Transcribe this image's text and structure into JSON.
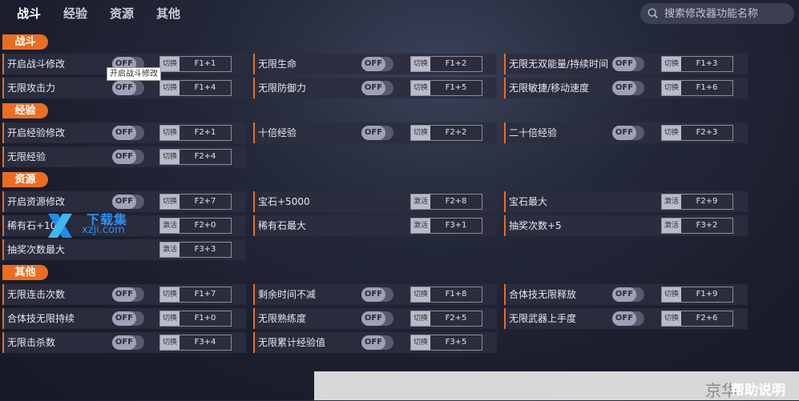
{
  "tabs": [
    {
      "label": "战斗",
      "active": true
    },
    {
      "label": "经验",
      "active": false
    },
    {
      "label": "资源",
      "active": false
    },
    {
      "label": "其他",
      "active": false
    }
  ],
  "search": {
    "placeholder": "搜索修改器功能名称"
  },
  "sections": [
    {
      "title": "战斗"
    },
    {
      "title": "经验"
    },
    {
      "title": "资源"
    },
    {
      "title": "其他"
    }
  ],
  "rows": [
    {
      "label": "开启战斗修改",
      "toggle": "OFF",
      "mode": "切换",
      "key": "F1+1"
    },
    {
      "label": "无限生命",
      "toggle": "OFF",
      "mode": "切换",
      "key": "F1+2"
    },
    {
      "label": "无限无双能量/持续时间",
      "toggle": "OFF",
      "mode": "切换",
      "key": "F1+3"
    },
    {
      "label": "无限攻击力",
      "toggle": "OFF",
      "mode": "切换",
      "key": "F1+4"
    },
    {
      "label": "无限防御力",
      "toggle": "OFF",
      "mode": "切换",
      "key": "F1+5"
    },
    {
      "label": "无限敏捷/移动速度",
      "toggle": "OFF",
      "mode": "切换",
      "key": "F1+6"
    },
    {
      "label": "开启经验修改",
      "toggle": "OFF",
      "mode": "切换",
      "key": "F2+1"
    },
    {
      "label": "十倍经验",
      "toggle": "OFF",
      "mode": "切换",
      "key": "F2+2"
    },
    {
      "label": "二十倍经验",
      "toggle": "OFF",
      "mode": "切换",
      "key": "F2+3"
    },
    {
      "label": "无限经验",
      "toggle": "OFF",
      "mode": "切换",
      "key": "F2+4"
    },
    {
      "label": "开启资源修改",
      "toggle": "OFF",
      "mode": "切换",
      "key": "F2+7"
    },
    {
      "label": "宝石+5000",
      "toggle": null,
      "mode": "激活",
      "key": "F2+8"
    },
    {
      "label": "宝石最大",
      "toggle": null,
      "mode": "激活",
      "key": "F2+9"
    },
    {
      "label": "稀有石+10",
      "toggle": null,
      "mode": "激活",
      "key": "F2+0"
    },
    {
      "label": "稀有石最大",
      "toggle": null,
      "mode": "激活",
      "key": "F3+1"
    },
    {
      "label": "抽奖次数+5",
      "toggle": null,
      "mode": "激活",
      "key": "F3+2"
    },
    {
      "label": "抽奖次数最大",
      "toggle": null,
      "mode": "激活",
      "key": "F3+3"
    },
    {
      "label": "无限连击次数",
      "toggle": "OFF",
      "mode": "切换",
      "key": "F1+7"
    },
    {
      "label": "剩余时间不减",
      "toggle": "OFF",
      "mode": "切换",
      "key": "F1+8"
    },
    {
      "label": "合体技无限释放",
      "toggle": "OFF",
      "mode": "切换",
      "key": "F1+9"
    },
    {
      "label": "合体技无限持续",
      "toggle": "OFF",
      "mode": "切换",
      "key": "F1+0"
    },
    {
      "label": "无限熟练度",
      "toggle": "OFF",
      "mode": "切换",
      "key": "F2+5"
    },
    {
      "label": "无限武器上手度",
      "toggle": "OFF",
      "mode": "切换",
      "key": "F2+6"
    },
    {
      "label": "无限击杀数",
      "toggle": "OFF",
      "mode": "切换",
      "key": "F3+4"
    },
    {
      "label": "无限累计经验值",
      "toggle": "OFF",
      "mode": "切换",
      "key": "F3+5"
    }
  ],
  "tooltip": "开启战斗修改",
  "watermark": {
    "title": "下载集",
    "url": "xzji.com"
  },
  "footer": {
    "site": "京华",
    "help": "帮助说明"
  },
  "colors": {
    "accent": "#ea6d23",
    "brand_blue": "#2f8ff0"
  }
}
